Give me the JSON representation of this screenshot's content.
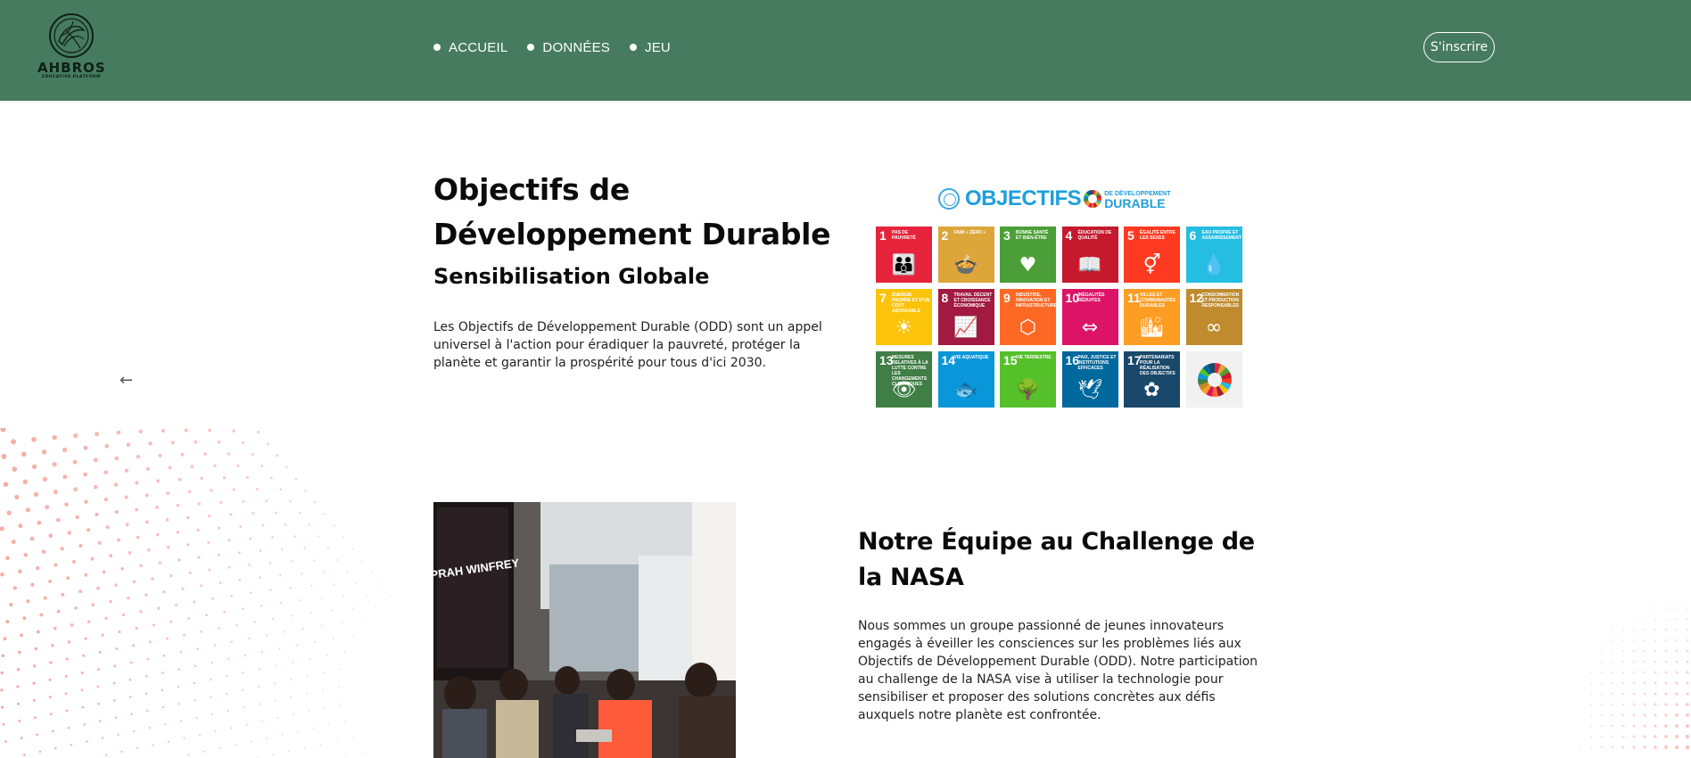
{
  "header": {
    "brand": "AHBROS",
    "brand_tagline": "EDUCATIVE PLATFORM",
    "nav": [
      {
        "label": "ACCUEIL"
      },
      {
        "label": "DONNÉES"
      },
      {
        "label": "JEU"
      }
    ],
    "signup_label": "S'inscrire",
    "background_color": "#467b5f"
  },
  "hero": {
    "title": "Objectifs de Développement Durable",
    "subtitle": "Sensibilisation Globale",
    "text": "Les Objectifs de Développement Durable (ODD) sont un appel universel à l'action pour éradiquer la pauvreté, protéger la planète et garantir la prospérité pour tous d'ici 2030.",
    "prev_icon": "←"
  },
  "sdg": {
    "heading_main": "OBJECTIFS",
    "heading_sub_1": "DE DÉVELOPPEMENT",
    "heading_sub_2": "DURABLE",
    "tiles": [
      {
        "num": "1",
        "label": "Pas de pauvreté",
        "color": "#e5243b",
        "icon": "👪"
      },
      {
        "num": "2",
        "label": "Faim « zéro »",
        "color": "#dda63a",
        "icon": "🍲"
      },
      {
        "num": "3",
        "label": "Bonne santé et bien-être",
        "color": "#4c9f38",
        "icon": "♥"
      },
      {
        "num": "4",
        "label": "Éducation de qualité",
        "color": "#c5192d",
        "icon": "📖"
      },
      {
        "num": "5",
        "label": "Égalité entre les sexes",
        "color": "#ff3a21",
        "icon": "⚥"
      },
      {
        "num": "6",
        "label": "Eau propre et assainissement",
        "color": "#26bde2",
        "icon": "💧"
      },
      {
        "num": "7",
        "label": "Énergie propre et d'un coût abordable",
        "color": "#fcc30b",
        "icon": "☀"
      },
      {
        "num": "8",
        "label": "Travail décent et croissance économique",
        "color": "#a21942",
        "icon": "📈"
      },
      {
        "num": "9",
        "label": "Industrie, innovation et infrastructure",
        "color": "#fd6925",
        "icon": "⬡"
      },
      {
        "num": "10",
        "label": "Inégalités réduites",
        "color": "#dd1367",
        "icon": "⇔"
      },
      {
        "num": "11",
        "label": "Villes et communautés durables",
        "color": "#fd9d24",
        "icon": "🏙"
      },
      {
        "num": "12",
        "label": "Consommation et production responsables",
        "color": "#bf8b2e",
        "icon": "∞"
      },
      {
        "num": "13",
        "label": "Mesures relatives à la lutte contre les changements climatiques",
        "color": "#3f7e44",
        "icon": "👁"
      },
      {
        "num": "14",
        "label": "Vie aquatique",
        "color": "#0a97d9",
        "icon": "🐟"
      },
      {
        "num": "15",
        "label": "Vie terrestre",
        "color": "#56c02b",
        "icon": "🌳"
      },
      {
        "num": "16",
        "label": "Paix, justice et institutions efficaces",
        "color": "#00689d",
        "icon": "🕊"
      },
      {
        "num": "17",
        "label": "Partenariats pour la réalisation des objectifs",
        "color": "#19486a",
        "icon": "✿"
      },
      {
        "num": "",
        "label": "",
        "color": "#f1f1f1",
        "icon": "sdg-wheel"
      }
    ]
  },
  "team": {
    "photo_sign": "OPRAH WINFREY",
    "title": "Notre Équipe au Challenge de la NASA",
    "text": "Nous sommes un groupe passionné de jeunes innovateurs engagés à éveiller les consciences sur les problèmes liés aux Objectifs de Développement Durable (ODD). Notre participation au challenge de la NASA vise à utiliser la technologie pour sensibiliser et proposer des solutions concrètes aux défis auxquels notre planète est confrontée."
  }
}
